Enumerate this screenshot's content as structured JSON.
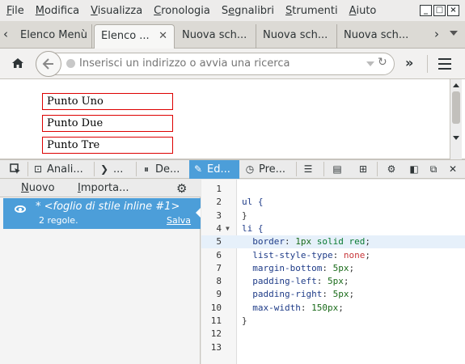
{
  "menubar": {
    "items": [
      {
        "pre": "",
        "ul": "F",
        "post": "ile"
      },
      {
        "pre": "",
        "ul": "M",
        "post": "odifica"
      },
      {
        "pre": "",
        "ul": "V",
        "post": "isualizza"
      },
      {
        "pre": "",
        "ul": "C",
        "post": "ronologia"
      },
      {
        "pre": "S",
        "ul": "e",
        "post": "gnalibri"
      },
      {
        "pre": "",
        "ul": "S",
        "post": "trumenti"
      },
      {
        "pre": "",
        "ul": "A",
        "post": "iuto"
      }
    ],
    "window_controls": [
      "_",
      "□",
      "×"
    ]
  },
  "tabs": [
    {
      "label": "Elenco Menù",
      "active": false
    },
    {
      "label": "Elenco ...",
      "active": true
    },
    {
      "label": "Nuova sch...",
      "active": false
    },
    {
      "label": "Nuova sch...",
      "active": false
    },
    {
      "label": "Nuova sch...",
      "active": false
    }
  ],
  "navbar": {
    "url_placeholder": "Inserisci un indirizzo o avvia una ricerca",
    "overflow_label": "»"
  },
  "page": {
    "list_items": [
      "Punto Uno",
      "Punto Due",
      "Punto Tre"
    ]
  },
  "devtools": {
    "tools": [
      {
        "icon": "inspector-icon",
        "label": ""
      },
      {
        "icon": "inspector-box-icon",
        "label": "Anali..."
      },
      {
        "icon": "console-icon",
        "label": "..."
      },
      {
        "icon": "debugger-icon",
        "label": "De..."
      },
      {
        "icon": "style-editor-icon",
        "label": "Ed...",
        "selected": true
      },
      {
        "icon": "performance-icon",
        "label": "Pre..."
      }
    ],
    "style_editor": {
      "new_label": {
        "ul": "N",
        "post": "uovo"
      },
      "import_label": {
        "ul": "I",
        "post": "mporta..."
      },
      "sheet_name": "* <foglio di stile inline #1>",
      "sheet_rules": "2 regole.",
      "sheet_save": "Salva"
    },
    "code_lines": [
      {
        "n": "1",
        "tokens": []
      },
      {
        "n": "2",
        "tokens": [
          {
            "t": "ul {",
            "c": "c-sel"
          }
        ]
      },
      {
        "n": "3",
        "tokens": [
          {
            "t": "}",
            "c": "c-pun"
          }
        ]
      },
      {
        "n": "4",
        "tokens": [
          {
            "t": "li {",
            "c": "c-sel"
          }
        ],
        "fold": true
      },
      {
        "n": "5",
        "tokens": [
          {
            "t": "  border",
            "c": "c-prop"
          },
          {
            "t": ": ",
            "c": "c-pun"
          },
          {
            "t": "1px",
            "c": "c-num"
          },
          {
            "t": " solid ",
            "c": "c-val"
          },
          {
            "t": "red",
            "c": "c-val"
          },
          {
            "t": ";",
            "c": "c-pun"
          }
        ],
        "highlight": true
      },
      {
        "n": "6",
        "tokens": [
          {
            "t": "  list-style-type",
            "c": "c-prop"
          },
          {
            "t": ": ",
            "c": "c-pun"
          },
          {
            "t": "none",
            "c": "c-val2"
          },
          {
            "t": ";",
            "c": "c-pun"
          }
        ]
      },
      {
        "n": "7",
        "tokens": [
          {
            "t": "  margin-bottom",
            "c": "c-prop"
          },
          {
            "t": ": ",
            "c": "c-pun"
          },
          {
            "t": "5px",
            "c": "c-num"
          },
          {
            "t": ";",
            "c": "c-pun"
          }
        ]
      },
      {
        "n": "8",
        "tokens": [
          {
            "t": "  padding-left",
            "c": "c-prop"
          },
          {
            "t": ": ",
            "c": "c-pun"
          },
          {
            "t": "5px",
            "c": "c-num"
          },
          {
            "t": ";",
            "c": "c-pun"
          }
        ]
      },
      {
        "n": "9",
        "tokens": [
          {
            "t": "  padding-right",
            "c": "c-prop"
          },
          {
            "t": ": ",
            "c": "c-pun"
          },
          {
            "t": "5px",
            "c": "c-num"
          },
          {
            "t": ";",
            "c": "c-pun"
          }
        ]
      },
      {
        "n": "10",
        "tokens": [
          {
            "t": "  max-width",
            "c": "c-prop"
          },
          {
            "t": ": ",
            "c": "c-pun"
          },
          {
            "t": "150px",
            "c": "c-num"
          },
          {
            "t": ";",
            "c": "c-pun"
          }
        ]
      },
      {
        "n": "11",
        "tokens": [
          {
            "t": "}",
            "c": "c-pun"
          }
        ]
      },
      {
        "n": "12",
        "tokens": []
      },
      {
        "n": "13",
        "tokens": []
      }
    ]
  },
  "colors": {
    "accent": "#4c9ed9",
    "list_border": "#dd0000"
  }
}
